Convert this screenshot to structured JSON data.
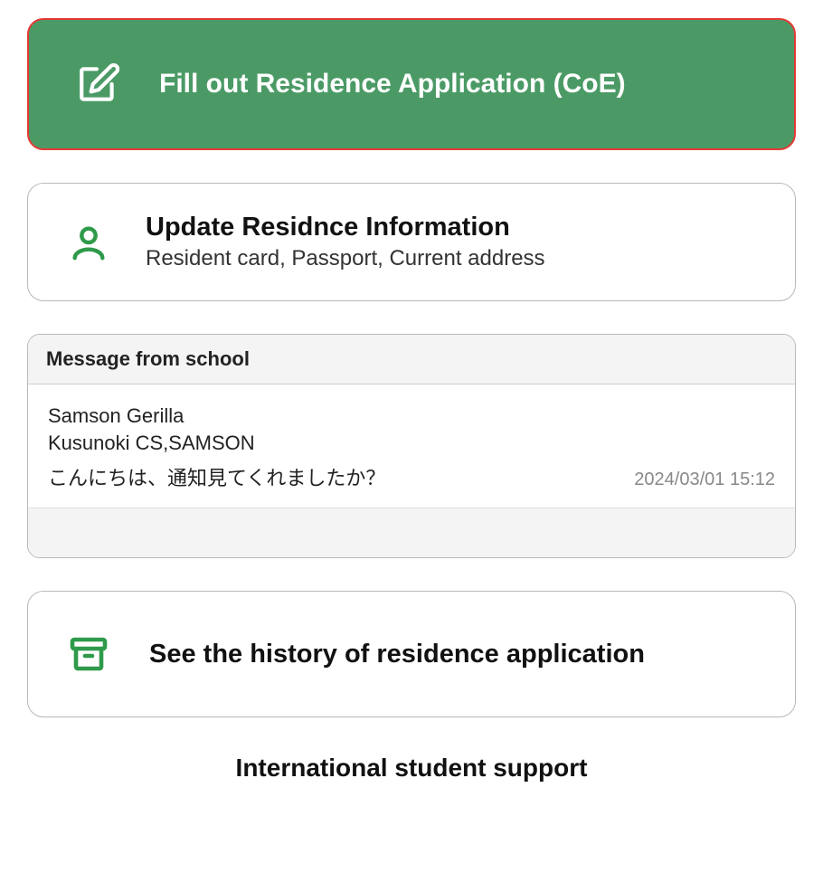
{
  "primary_button": {
    "label": "Fill out Residence Application (CoE)"
  },
  "update_card": {
    "title": "Update Residnce Information",
    "subtitle": "Resident card, Passport, Current address"
  },
  "message_box": {
    "header": "Message from school",
    "line1": "Samson Gerilla",
    "line2": "Kusunoki CS,SAMSON",
    "content": "こんにちは、通知見てくれましたか？",
    "timestamp": "2024/03/01 15:12"
  },
  "history_card": {
    "label": "See the history of residence application"
  },
  "footer": {
    "text": "International student support"
  },
  "colors": {
    "primary_green": "#4b9a66",
    "highlight_red": "#e53935",
    "icon_green": "#2e9a4a"
  }
}
